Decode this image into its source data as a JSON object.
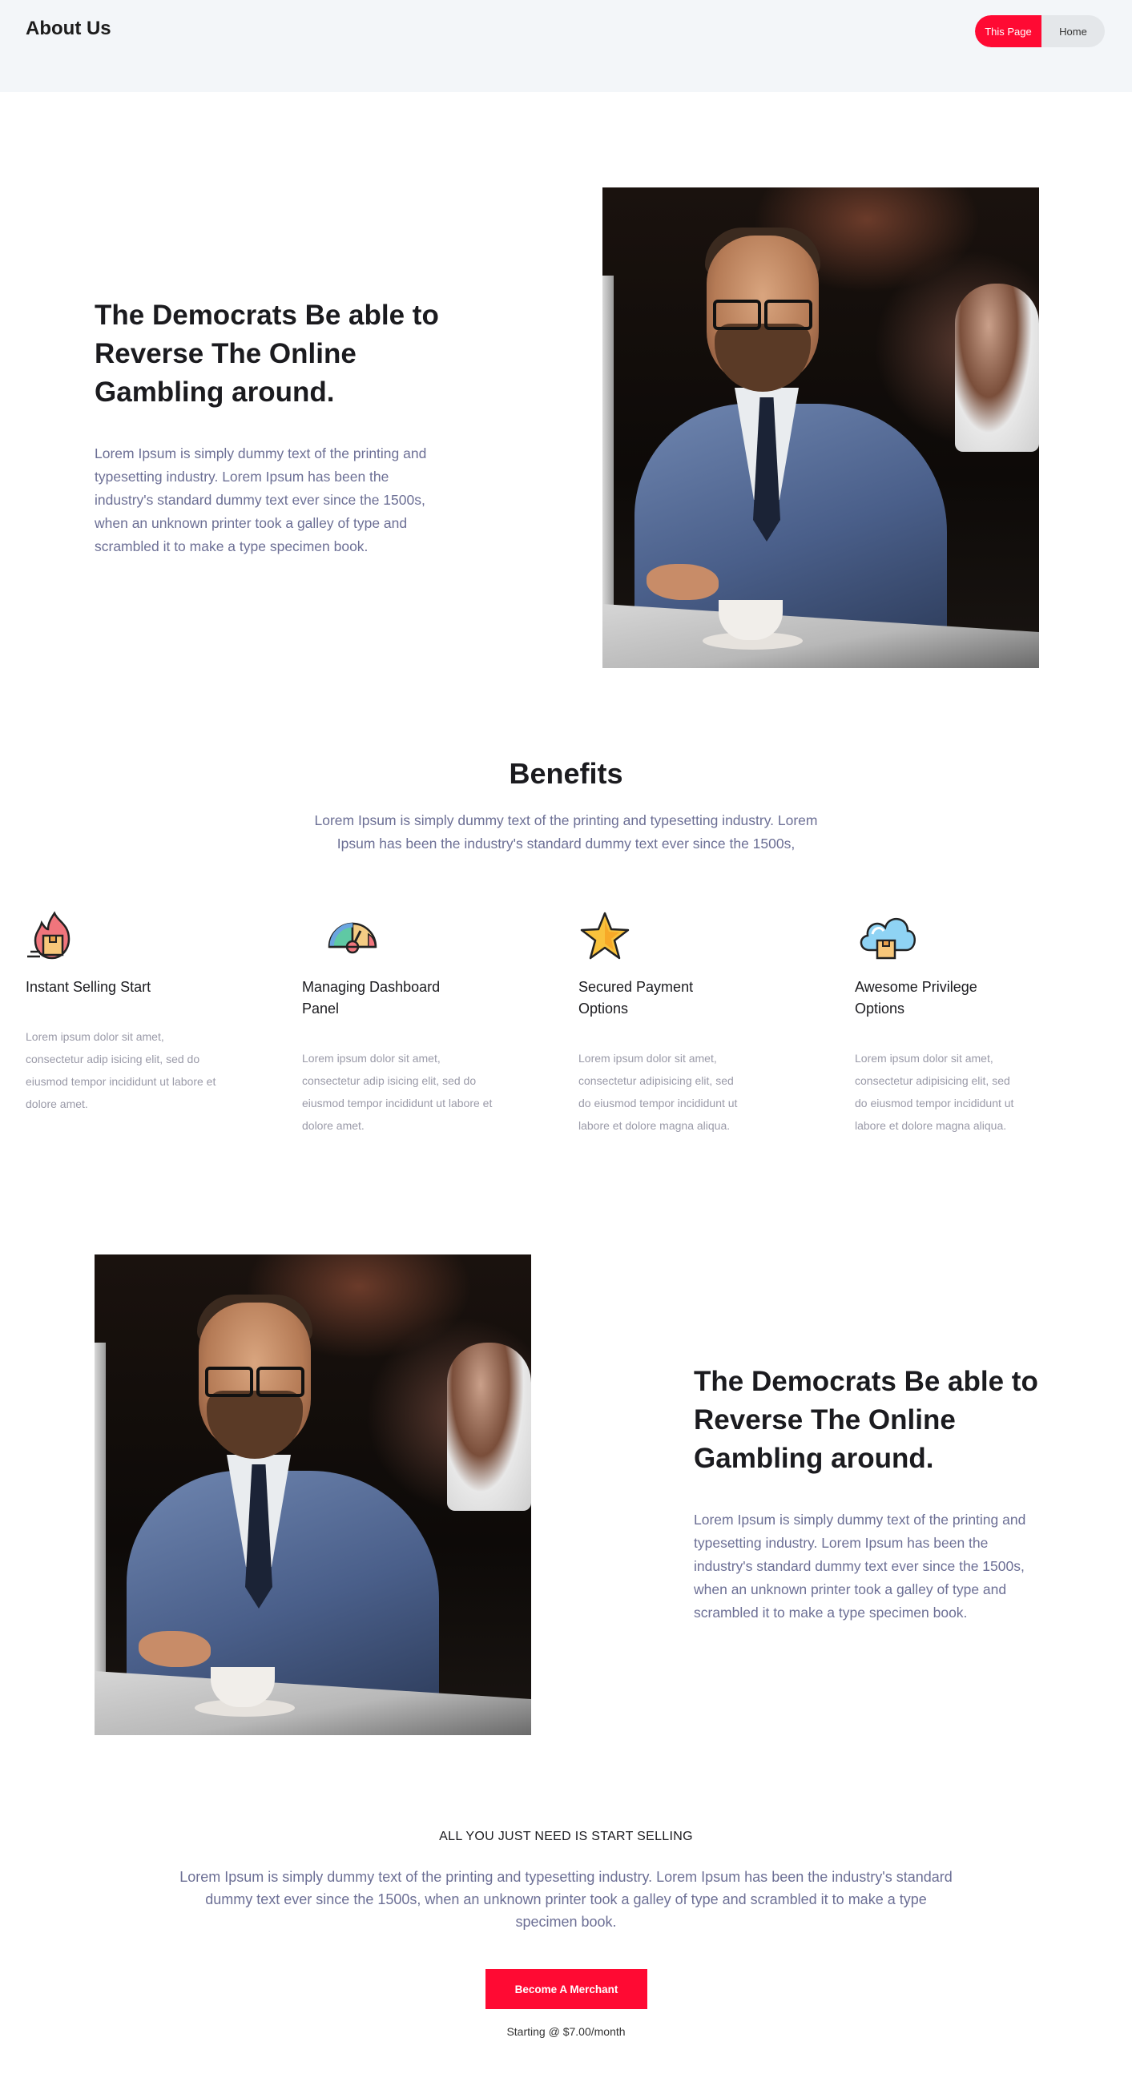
{
  "header": {
    "title": "About Us",
    "breadcrumb": {
      "current": "This Page",
      "home": "Home"
    }
  },
  "intro": {
    "headline": "The Democrats Be able to Reverse The Online Gambling around.",
    "text": "Lorem Ipsum is simply dummy text of the printing and typesetting industry. Lorem Ipsum has been the industry's standard dummy text ever since the 1500s, when an unknown printer took a galley of type and scrambled it to make a type specimen book."
  },
  "benefits": {
    "title": "Benefits",
    "subtitle": "Lorem Ipsum is simply dummy text of the printing and typesetting industry. Lorem Ipsum has been the industry's standard dummy text ever since the 1500s,",
    "items": [
      {
        "icon": "fire-box-icon",
        "title": "Instant Selling Start",
        "text": "Lorem ipsum dolor sit amet, consectetur adip isicing elit, sed do eiusmod tempor incididunt ut labore et dolore amet."
      },
      {
        "icon": "speedometer-icon",
        "title": "Managing Dashboard Panel",
        "text": "Lorem ipsum dolor sit amet, consectetur adip isicing elit, sed do eiusmod tempor incididunt ut labore et dolore amet."
      },
      {
        "icon": "star-icon",
        "title": "Secured Payment Options",
        "text": "Lorem ipsum dolor sit amet, consectetur adipisicing elit, sed do eiusmod tempor incididunt ut labore et dolore magna aliqua."
      },
      {
        "icon": "cloud-box-icon",
        "title": "Awesome Privilege Options",
        "text": "Lorem ipsum dolor sit amet, consectetur adipisicing elit, sed do eiusmod tempor incididunt ut labore et dolore magna aliqua."
      }
    ]
  },
  "second": {
    "headline": "The Democrats Be able to Reverse The Online Gambling around.",
    "text": "Lorem Ipsum is simply dummy text of the printing and typesetting industry. Lorem Ipsum has been the industry's standard dummy text ever since the 1500s, when an unknown printer took a galley of type and scrambled it to make a type specimen book."
  },
  "cta": {
    "kicker": "ALL YOU JUST NEED IS START SELLING",
    "text": "Lorem Ipsum is simply dummy text of the printing and typesetting industry. Lorem Ipsum has been the industry's standard dummy text ever since the 1500s, when an unknown printer took a galley of type and scrambled it to make a type specimen book.",
    "button": "Become A Merchant",
    "price": "Starting @ $7.00/month"
  },
  "colors": {
    "accent": "#ff0a33",
    "header_bg": "#f3f6f9",
    "body_text": "#6c6f95",
    "heading": "#1b1b1f"
  }
}
